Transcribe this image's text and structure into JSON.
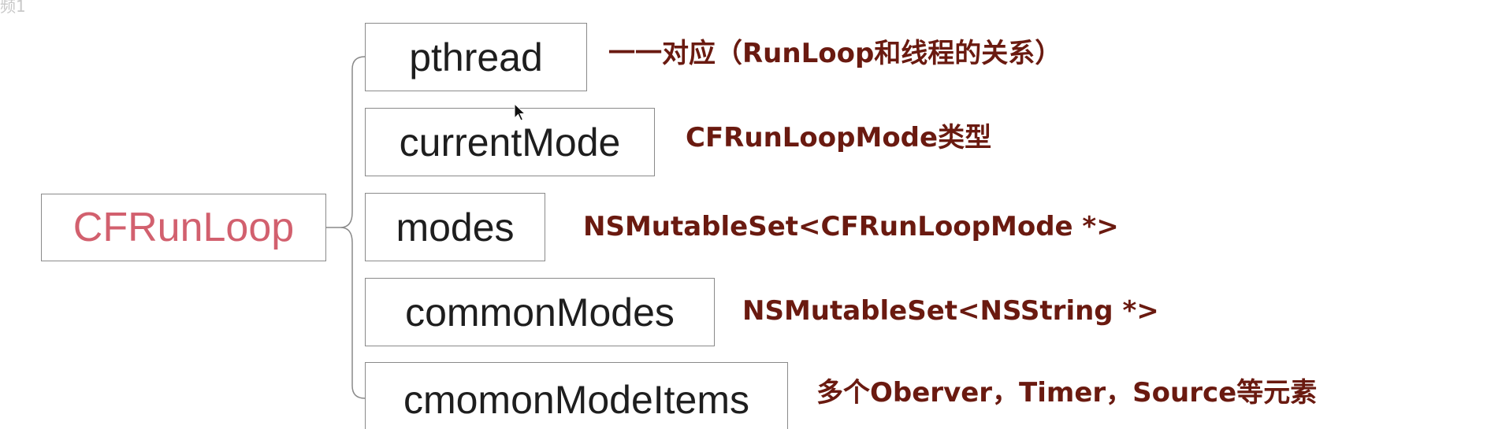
{
  "corner_text": "频1",
  "root": {
    "label": "CFRunLoop"
  },
  "members": [
    {
      "label": "pthread",
      "description": "一一对应（RunLoop和线程的关系）"
    },
    {
      "label": "currentMode",
      "description": "CFRunLoopMode类型"
    },
    {
      "label": "modes",
      "description": "NSMutableSet<CFRunLoopMode *>"
    },
    {
      "label": "commonModes",
      "description": "NSMutableSet<NSString *>"
    },
    {
      "label": "cmomonModeItems",
      "description": "多个Oberver，Timer，Source等元素"
    }
  ],
  "colors": {
    "root_text": "#d2606e",
    "member_text": "#1e1e1e",
    "description_text": "#6a1a10",
    "box_border": "#8a8a8a",
    "connector": "#8a8a8a"
  }
}
